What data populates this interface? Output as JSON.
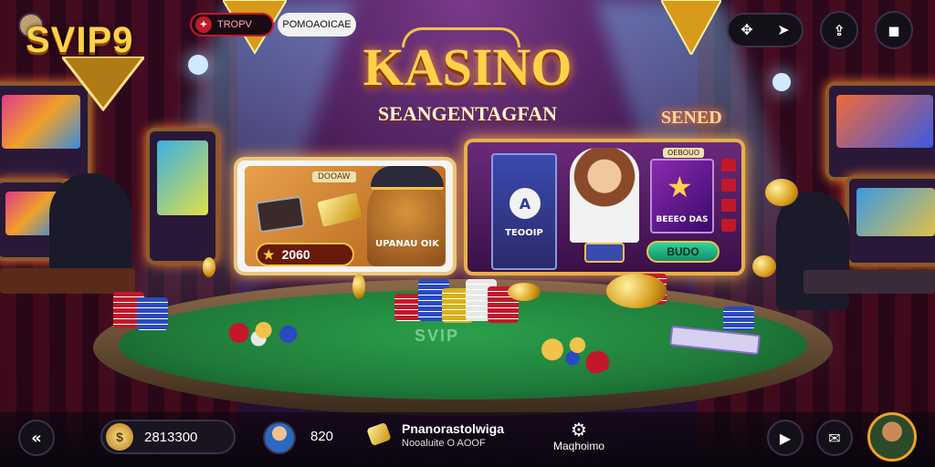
{
  "header": {
    "logo": "SVIP9",
    "badge_label": "TROPV",
    "tag_label": "POMOAOICAE"
  },
  "hero": {
    "title": "KASINO",
    "subtitle": "SEANGENTAGFAN",
    "neon_sign": "SENED"
  },
  "promo_card_left": {
    "label": "DOOAW",
    "amount": "2060",
    "mascot_text": "UPANAU OIK"
  },
  "promo_card_right": {
    "label_top": "OEBOUO",
    "tile_label": "TEOOIP",
    "tile_right_label": "BEEEO DAS",
    "button": "BUDO"
  },
  "table": {
    "felt_text": "SVIP"
  },
  "bottom_bar": {
    "balance": "2813300",
    "score": "820",
    "promo_line1": "Pnanorastolwiga",
    "promo_line2": "Nooaluite O AOOF",
    "settings_label": "Maqhoimo"
  },
  "colors": {
    "gold": "#f2c24a",
    "felt": "#1f7a3a",
    "accent_red": "#c2182a",
    "purple": "#3a1448"
  }
}
